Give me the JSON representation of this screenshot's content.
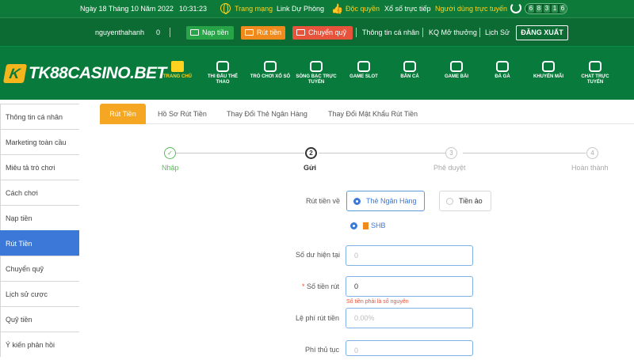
{
  "topbar": {
    "date": "Ngày 18 Tháng 10 Năm 2022",
    "time": "10:31:23",
    "network_label": "Trang mạng",
    "backup_link": "Link Dự Phòng",
    "exclusive": "Độc quyền",
    "lottery_live": "Xổ số trực tiếp",
    "online_users_label": "Người dùng trực tuyến",
    "online_digits": [
      "6",
      "8",
      "3",
      "1",
      "6"
    ]
  },
  "userbar": {
    "username": "nguyenthahanh",
    "balance": "0",
    "deposit_label": "Nạp tiền",
    "withdraw_label": "Rút tiền",
    "transfer_label": "Chuyển quỹ",
    "personal_info": "Thông tin cá nhân",
    "lottery_results": "KQ Mở thưởng",
    "history": "Lịch Sử",
    "logout": "ĐĂNG XUẤT"
  },
  "brand": {
    "logo_text": "TK88CASINO.BET"
  },
  "nav": {
    "items": [
      {
        "label": "TRANG CHỦ",
        "icon": "home-icon",
        "active": true
      },
      {
        "label": "THI ĐẤU THỂ THAO",
        "icon": "soccer-ball-icon"
      },
      {
        "label": "TRÒ CHƠI XỔ SỐ",
        "icon": "lottery-balls-icon"
      },
      {
        "label": "SÒNG BẠC TRỰC TUYẾN",
        "icon": "casino-chip-icon"
      },
      {
        "label": "GAME SLOT",
        "icon": "slot-machine-icon"
      },
      {
        "label": "BẮN CÁ",
        "icon": "fish-icon"
      },
      {
        "label": "GAME BÀI",
        "icon": "dice-icon"
      },
      {
        "label": "ĐÁ GÀ",
        "icon": "rooster-icon"
      },
      {
        "label": "KHUYẾN MÃI",
        "icon": "gift-icon"
      },
      {
        "label": "CHAT TRỰC TUYẾN",
        "icon": "headset-icon"
      }
    ]
  },
  "sidebar": {
    "items": [
      {
        "label": "Thông tin cá nhân"
      },
      {
        "label": "Marketing toàn cầu"
      },
      {
        "label": "Miêu tả trò chơi"
      },
      {
        "label": "Cách chơi"
      },
      {
        "label": "Nạp tiền"
      },
      {
        "label": "Rút Tiền",
        "active": true
      },
      {
        "label": "Chuyển quỹ"
      },
      {
        "label": "Lịch sử cược"
      },
      {
        "label": "Quỹ tiền"
      },
      {
        "label": "Ý kiến phản hồi"
      }
    ]
  },
  "tabs": [
    {
      "label": "Rút Tiền",
      "active": true
    },
    {
      "label": "Hồ Sơ Rút Tiền"
    },
    {
      "label": "Thay Đổi Thẻ Ngân Hàng"
    },
    {
      "label": "Thay Đổi Mật Khẩu Rút Tiền"
    }
  ],
  "steps": [
    {
      "num": "",
      "label": "Nhập",
      "state": "done"
    },
    {
      "num": "2",
      "label": "Gửi",
      "state": "current"
    },
    {
      "num": "3",
      "label": "Phê duyệt",
      "state": "todo"
    },
    {
      "num": "4",
      "label": "Hoàn thành",
      "state": "todo"
    }
  ],
  "form": {
    "withdraw_to_label": "Rút tiền về",
    "option_bank": "Thẻ Ngân Hàng",
    "option_virtual": "Tiền ảo",
    "bank_name": "SHB",
    "balance_label": "Số dư hiện tại",
    "balance_placeholder": "0",
    "amount_req": "*",
    "amount_label": "Số tiền rút",
    "amount_value": "0",
    "amount_hint": "Số tiền phải là số nguyên",
    "fee_label": "Lệ phí rút tiền",
    "fee_placeholder": "0.00%",
    "procedure_label": "Phí thủ tục",
    "procedure_placeholder": "0"
  }
}
